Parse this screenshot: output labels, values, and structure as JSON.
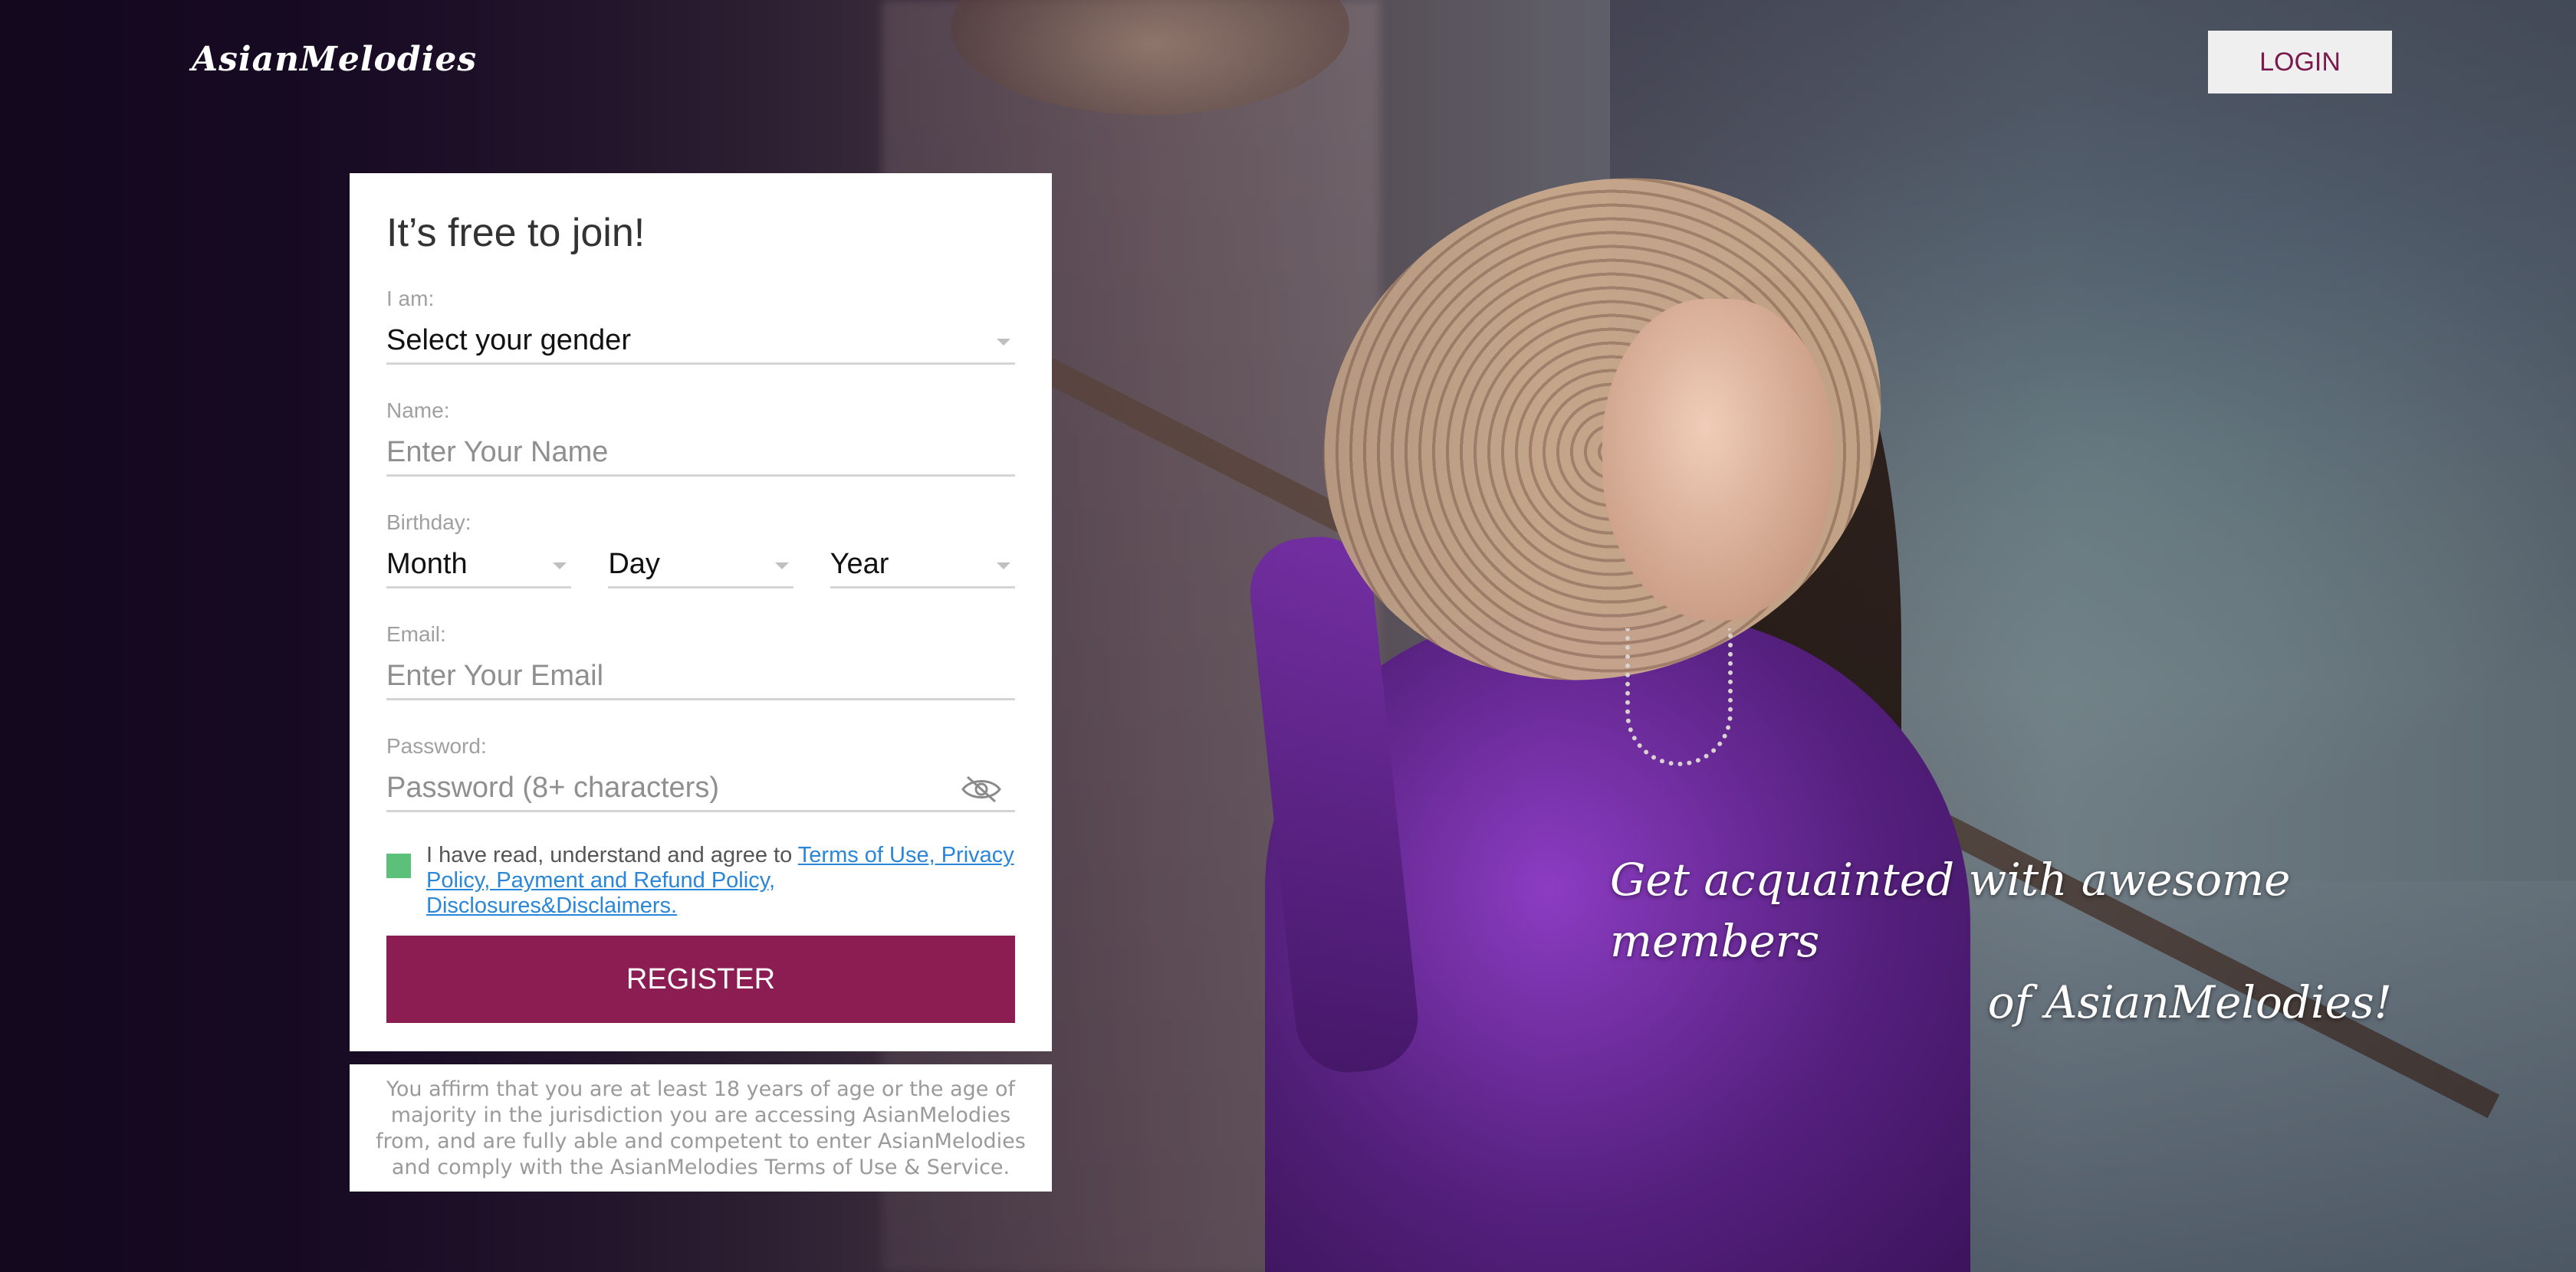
{
  "header": {
    "logo": "AsianMelodies",
    "login_label": "LOGIN"
  },
  "form": {
    "title": "It’s free to join!",
    "gender": {
      "label": "I am:",
      "value": "Select your gender"
    },
    "name": {
      "label": "Name:",
      "placeholder": "Enter Your Name"
    },
    "birthday": {
      "label": "Birthday:",
      "month": "Month",
      "day": "Day",
      "year": "Year"
    },
    "email": {
      "label": "Email:",
      "placeholder": "Enter Your Email"
    },
    "password": {
      "label": "Password:",
      "placeholder": "Password (8+ characters)"
    },
    "agree": {
      "text": "I have read, understand and agree to ",
      "link_text": "Terms of Use, Privacy Policy, Payment and Refund Policy, Disclosures&Disclaimers.",
      "checked": true
    },
    "register_label": "REGISTER"
  },
  "disclaimer": "You affirm that you are at least 18 years of age or the age of majority in the jurisdiction you are accessing AsianMelodies from, and are fully able and competent to enter AsianMelodies and comply with the AsianMelodies Terms of Use & Service.",
  "tagline": {
    "line1": "Get acquainted with awesome members",
    "line2": "of AsianMelodies!"
  },
  "colors": {
    "accent": "#8c1d52",
    "link": "#2a86d8",
    "checkbox": "#5cc07a"
  },
  "icons": {
    "password_toggle": "eye-slash-icon",
    "dropdown": "caret-down-icon"
  }
}
